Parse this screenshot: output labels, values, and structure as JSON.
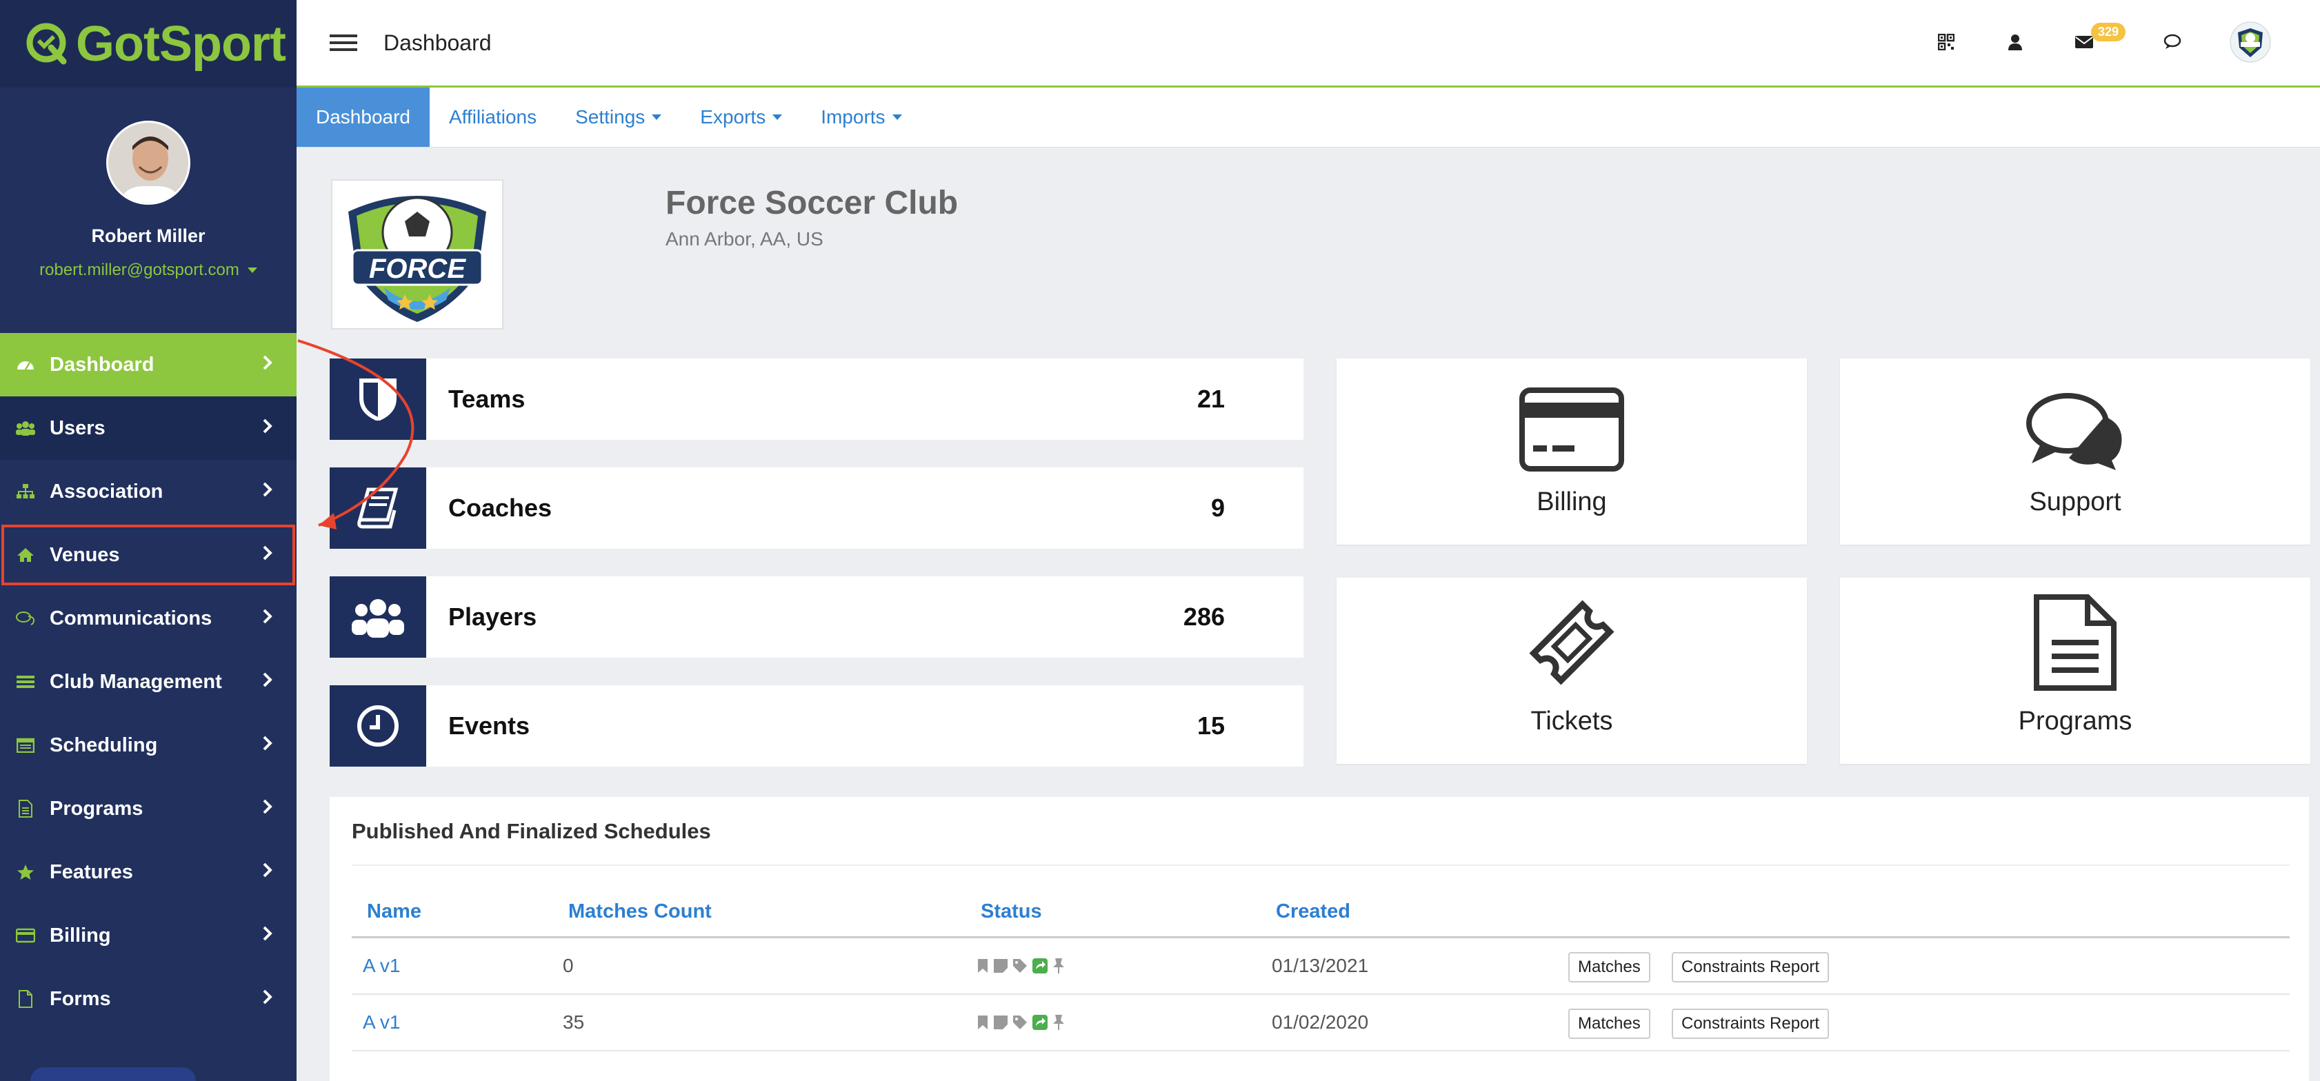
{
  "brand": {
    "name": "GotSport"
  },
  "user": {
    "name": "Robert Miller",
    "email": "robert.miller@gotsport.com"
  },
  "sidebar": {
    "items": [
      {
        "label": "Dashboard",
        "icon": "dashboard-icon"
      },
      {
        "label": "Users",
        "icon": "users-icon"
      },
      {
        "label": "Association",
        "icon": "sitemap-icon"
      },
      {
        "label": "Venues",
        "icon": "home-icon"
      },
      {
        "label": "Communications",
        "icon": "comments-icon"
      },
      {
        "label": "Club Management",
        "icon": "list-icon"
      },
      {
        "label": "Scheduling",
        "icon": "calendar-icon"
      },
      {
        "label": "Programs",
        "icon": "document-icon"
      },
      {
        "label": "Features",
        "icon": "star-icon"
      },
      {
        "label": "Billing",
        "icon": "credit-card-icon"
      },
      {
        "label": "Forms",
        "icon": "file-icon"
      }
    ]
  },
  "topbar": {
    "title": "Dashboard",
    "mail_count": "329"
  },
  "tabs": [
    "Dashboard",
    "Affiliations",
    "Settings",
    "Exports",
    "Imports"
  ],
  "club": {
    "name": "Force Soccer Club",
    "location": "Ann Arbor, AA, US",
    "logo_text": "FORCE"
  },
  "stats": [
    {
      "label": "Teams",
      "value": "21"
    },
    {
      "label": "Coaches",
      "value": "9"
    },
    {
      "label": "Players",
      "value": "286"
    },
    {
      "label": "Events",
      "value": "15"
    }
  ],
  "tiles": [
    {
      "label": "Billing"
    },
    {
      "label": "Support"
    },
    {
      "label": "Tickets"
    },
    {
      "label": "Programs"
    }
  ],
  "schedules": {
    "title": "Published And Finalized Schedules",
    "columns": [
      "Name",
      "Matches Count",
      "Status",
      "Created"
    ],
    "rows": [
      {
        "name": "A v1",
        "matches": "0",
        "created": "01/13/2021"
      },
      {
        "name": "A v1",
        "matches": "35",
        "created": "01/02/2020"
      }
    ],
    "buttons": {
      "matches": "Matches",
      "constraints": "Constraints Report"
    }
  },
  "colors": {
    "brand_green": "#8dc63f",
    "sidebar_navy": "#21305d",
    "link_blue": "#2d7fd1",
    "annotation_red": "#e8432d"
  }
}
